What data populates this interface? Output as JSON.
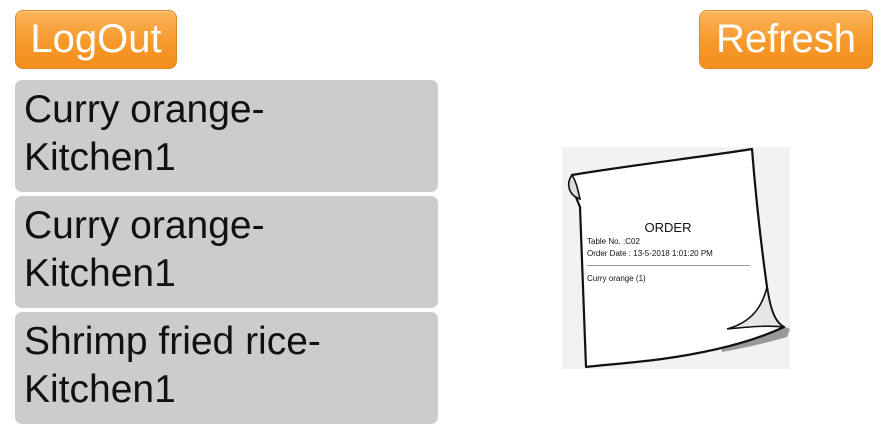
{
  "header": {
    "logout_label": "LogOut",
    "refresh_label": "Refresh"
  },
  "orders": [
    {
      "line1": "Curry orange-",
      "line2": "Kitchen1"
    },
    {
      "line1": "Curry orange-",
      "line2": "Kitchen1"
    },
    {
      "line1": "Shrimp fried rice-",
      "line2": "Kitchen1"
    }
  ],
  "receipt": {
    "title": "ORDER",
    "table_line": "Table No. :C02",
    "date_line": "Order Date : 13-5-2018  1:01:20 PM",
    "item_line": "Curry orange  (1)"
  },
  "colors": {
    "button_orange": "#f7992b",
    "button_text": "#ffffff",
    "list_item_bg": "#cccccc"
  }
}
